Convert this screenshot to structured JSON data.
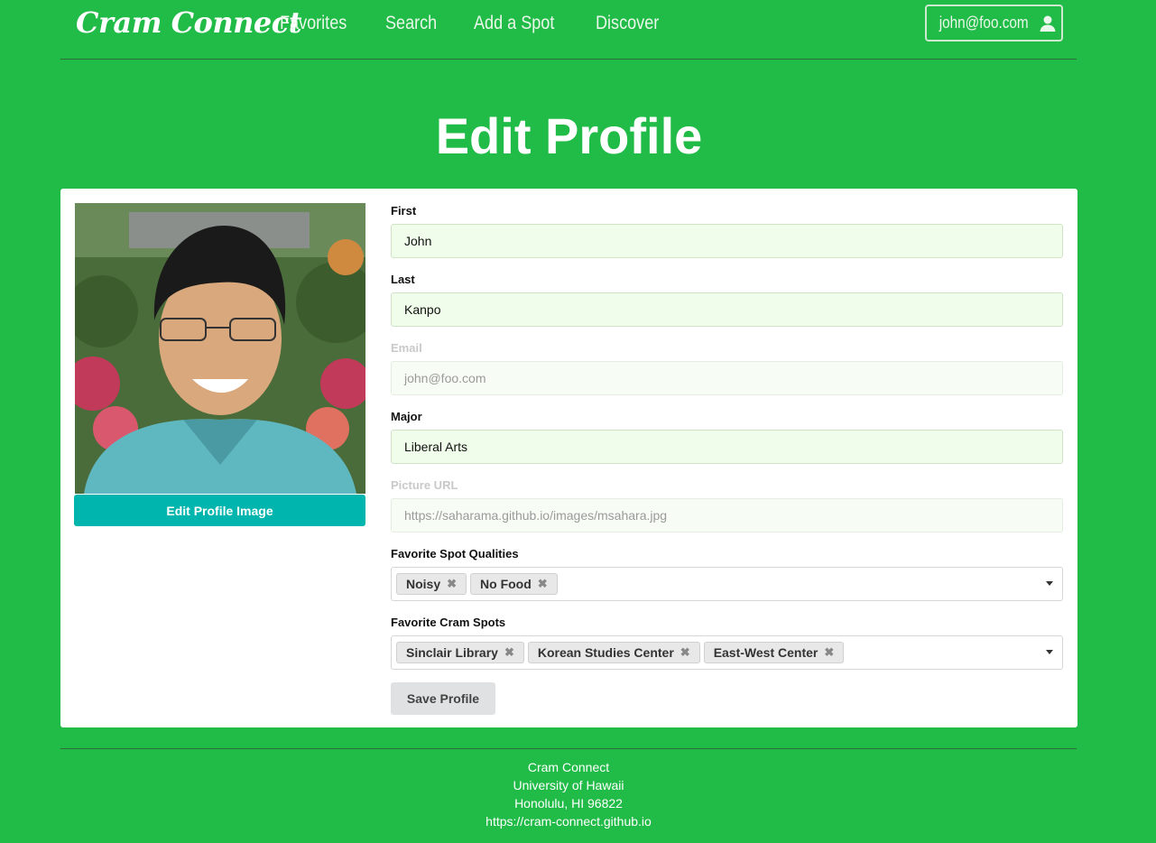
{
  "nav": {
    "brand": "Cram Connect",
    "links": [
      "Favorites",
      "Search",
      "Add a Spot",
      "Discover"
    ],
    "user": "john@foo.com"
  },
  "page_title": "Edit Profile",
  "profile": {
    "edit_image_label": "Edit Profile Image",
    "fields": {
      "first": {
        "label": "First",
        "value": "John"
      },
      "last": {
        "label": "Last",
        "value": "Kanpo"
      },
      "email": {
        "label": "Email",
        "value": "john@foo.com"
      },
      "major": {
        "label": "Major",
        "value": "Liberal Arts"
      },
      "picture": {
        "label": "Picture URL",
        "value": "https://saharama.github.io/images/msahara.jpg"
      }
    },
    "qualities": {
      "label": "Favorite Spot Qualities",
      "chips": [
        "Noisy",
        "No Food"
      ]
    },
    "spots": {
      "label": "Favorite Cram Spots",
      "chips": [
        "Sinclair Library",
        "Korean Studies Center",
        "East-West Center"
      ]
    },
    "save_label": "Save Profile"
  },
  "footer": {
    "lines": [
      "Cram Connect",
      "University of Hawaii",
      "Honolulu, HI 96822",
      "https://cram-connect.github.io"
    ]
  },
  "colors": {
    "background": "#21bb47",
    "teal_button": "#00b5ad",
    "input_bg": "#f0fdeb"
  },
  "icons": {
    "user": "user-icon",
    "remove_chip": "close-icon",
    "dropdown": "chevron-down-icon"
  }
}
